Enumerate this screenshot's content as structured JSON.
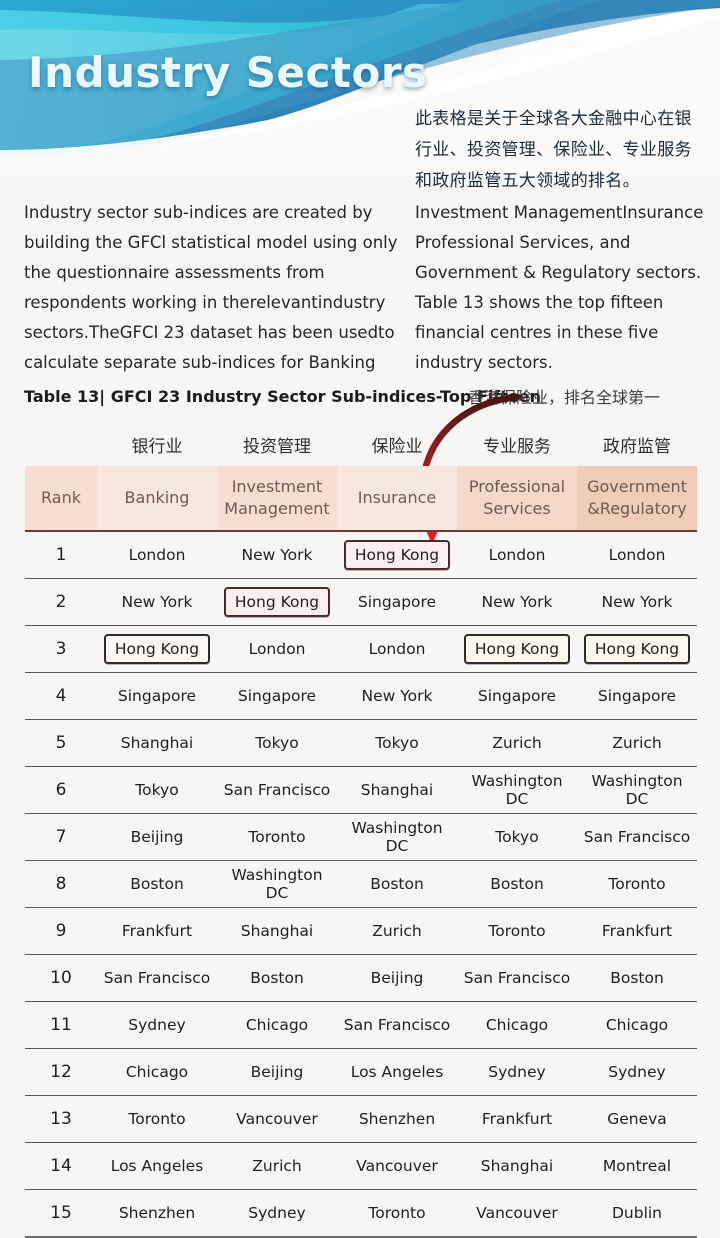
{
  "banner": {
    "title": "Industry Sectors",
    "colors": {
      "deep_blue": "#1b5fa8",
      "mid_blue": "#2f8fc4",
      "cyan": "#30c4de",
      "light_cyan": "#6fd8e8",
      "steel": "#3f86b8"
    }
  },
  "intro_cn": "此表格是关于全球各大金融中心在银行业、投资管理、保险业、专业服务和政府监管五大领域的排名。",
  "paragraph_left": "Industry sector sub-indices are created by building the GFCl statistical model using only the questionnaire assessments from respondents working in therelevantindustry sectors.TheGFCI 23 dataset has been usedto calculate separate sub-indices for Banking",
  "paragraph_right": "Investment ManagementInsurance Professional Services, and Government & Regulatory sectors. Table 13 shows the top fifteen financial centres in these five industry sectors.",
  "table_caption": "Table 13| GFCI 23 Industry Sector Sub-indices-Top Fifteen",
  "annotation_cn": "香港保险业，排名全球第一",
  "annotation_color": "#8e1f20",
  "chart_data": {
    "type": "table",
    "title": "Table 13| GFCI 23 Industry Sector Sub-indices-Top Fifteen",
    "headers_cn": [
      "",
      "银行业",
      "投资管理",
      "保险业",
      "专业服务",
      "政府监管"
    ],
    "headers_en": [
      "Rank",
      "Banking",
      "Investment Management",
      "Insurance",
      "Professional Services",
      "Government &Regulatory"
    ],
    "header_bg": "#f6ded2",
    "highlight_value": "Hong Kong",
    "highlight_cells": [
      [
        1,
        3
      ],
      [
        2,
        2
      ],
      [
        3,
        1
      ],
      [
        3,
        4
      ],
      [
        3,
        5
      ]
    ],
    "rows": [
      {
        "rank": "1",
        "cells": [
          "London",
          "New York",
          "Hong Kong",
          "London",
          "London"
        ]
      },
      {
        "rank": "2",
        "cells": [
          "New York",
          "Hong Kong",
          "Singapore",
          "New York",
          "New York"
        ]
      },
      {
        "rank": "3",
        "cells": [
          "Hong Kong",
          "London",
          "London",
          "Hong Kong",
          "Hong Kong"
        ]
      },
      {
        "rank": "4",
        "cells": [
          "Singapore",
          "Singapore",
          "New York",
          "Singapore",
          "Singapore"
        ]
      },
      {
        "rank": "5",
        "cells": [
          "Shanghai",
          "Tokyo",
          "Tokyo",
          "Zurich",
          "Zurich"
        ]
      },
      {
        "rank": "6",
        "cells": [
          "Tokyo",
          "San Francisco",
          "Shanghai",
          "Washington DC",
          "Washington DC"
        ]
      },
      {
        "rank": "7",
        "cells": [
          "Beijing",
          "Toronto",
          "Washington DC",
          "Tokyo",
          "San Francisco"
        ]
      },
      {
        "rank": "8",
        "cells": [
          "Boston",
          "Washington DC",
          "Boston",
          "Boston",
          "Toronto"
        ]
      },
      {
        "rank": "9",
        "cells": [
          "Frankfurt",
          "Shanghai",
          "Zurich",
          "Toronto",
          "Frankfurt"
        ]
      },
      {
        "rank": "10",
        "cells": [
          "San Francisco",
          "Boston",
          "Beijing",
          "San Francisco",
          "Boston"
        ]
      },
      {
        "rank": "11",
        "cells": [
          "Sydney",
          "Chicago",
          "San Francisco",
          "Chicago",
          "Chicago"
        ]
      },
      {
        "rank": "12",
        "cells": [
          "Chicago",
          "Beijing",
          "Los Angeles",
          "Sydney",
          "Sydney"
        ]
      },
      {
        "rank": "13",
        "cells": [
          "Toronto",
          "Vancouver",
          "Shenzhen",
          "Frankfurt",
          "Geneva"
        ]
      },
      {
        "rank": "14",
        "cells": [
          "Los Angeles",
          "Zurich",
          "Vancouver",
          "Shanghai",
          "Montreal"
        ]
      },
      {
        "rank": "15",
        "cells": [
          "Shenzhen",
          "Sydney",
          "Toronto",
          "Vancouver",
          "Dublin"
        ]
      }
    ]
  }
}
